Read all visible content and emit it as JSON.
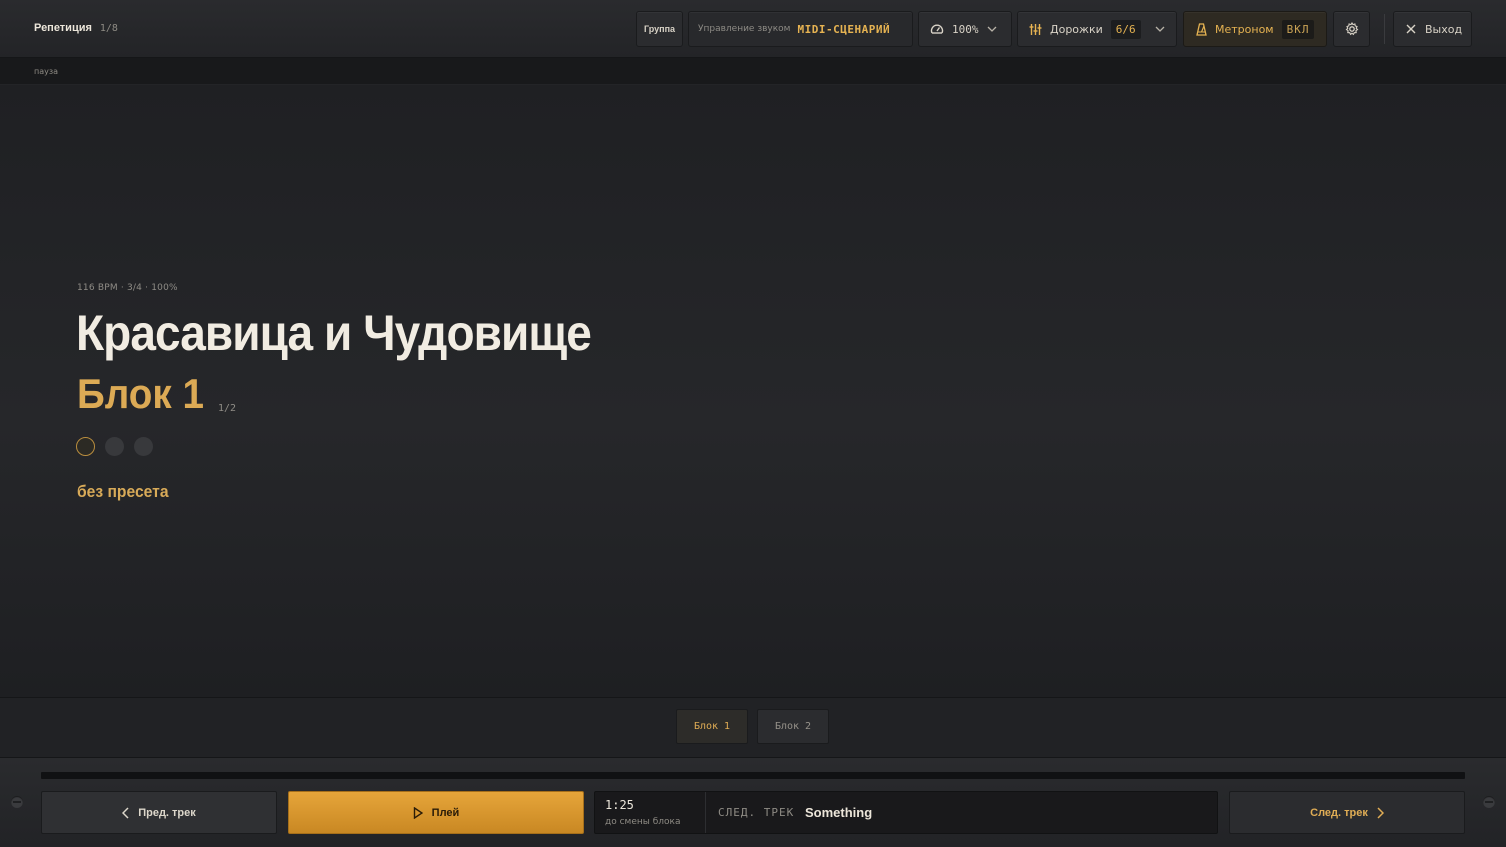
{
  "header": {
    "title": "Репетиция",
    "counter": "1/8",
    "group_label": "Группа",
    "sound_label": "Управление звуком",
    "sound_value": "MIDI-СЦЕНАРИЙ",
    "zoom_value": "100%",
    "tracks_label": "Дорожки",
    "tracks_value": "6/6",
    "metronome_label": "Метроном",
    "metronome_value": "ВКЛ",
    "exit_label": "Выход"
  },
  "status": {
    "text": "пауза"
  },
  "song": {
    "meta": "116 BPM · 3/4 · 100%",
    "title": "Красавица и Чудовище",
    "block_title": "Блок 1",
    "block_position": "1/2",
    "preset": "без пресета"
  },
  "blocks": [
    {
      "label": "Блок 1",
      "active": true
    },
    {
      "label": "Блок 2",
      "active": false
    }
  ],
  "transport": {
    "prev_label": "Пред. трек",
    "play_label": "Плей",
    "next_label": "След. трек",
    "time": "1:25",
    "time_caption": "до смены блока",
    "next_track_caption": "СЛЕД. ТРЕК",
    "next_track_name": "Something"
  },
  "colors": {
    "accent": "#e6b352",
    "play_button": "#dfa035",
    "background": "#1d1e21"
  }
}
